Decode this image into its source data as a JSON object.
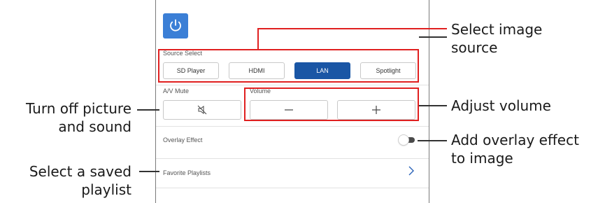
{
  "panel": {
    "source_select_label": "Source Select",
    "sources": [
      {
        "label": "SD Player",
        "active": false
      },
      {
        "label": "HDMI",
        "active": false
      },
      {
        "label": "LAN",
        "active": true
      },
      {
        "label": "Spotlight",
        "active": false
      }
    ],
    "av_mute_label": "A/V Mute",
    "volume_label": "Volume",
    "overlay_effect_label": "Overlay Effect",
    "overlay_effect_enabled": false,
    "favorite_playlists_label": "Favorite Playlists",
    "icons": {
      "power": "power-icon",
      "av_mute": "mute-icon",
      "volume_down": "minus-icon",
      "volume_up": "plus-icon",
      "playlist_arrow": "chevron-right-icon"
    }
  },
  "callouts": {
    "select_image_source": [
      "Select image",
      "source"
    ],
    "adjust_volume": [
      "Adjust volume"
    ],
    "add_overlay_effect": [
      "Add overlay effect",
      "to image"
    ],
    "turn_off_picture": [
      "Turn off picture",
      "and sound"
    ],
    "select_saved_playlist": [
      "Select a saved",
      "playlist"
    ]
  },
  "colors": {
    "accent": "#3b7fd6",
    "active_source": "#1a56a5",
    "highlight": "#e02020",
    "toggle_track": "#4a4a4a"
  }
}
